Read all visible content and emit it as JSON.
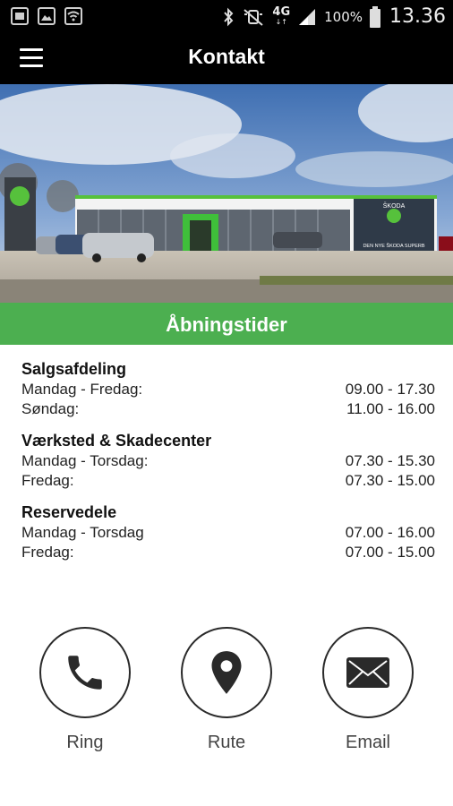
{
  "status_bar": {
    "network": "4G",
    "battery": "100%",
    "time": "13.36",
    "icons": [
      "storage-icon",
      "image-icon",
      "wifi-icon",
      "bluetooth-icon",
      "mute-icon",
      "signal-icon",
      "battery-icon"
    ]
  },
  "app_bar": {
    "title": "Kontakt",
    "menu_icon": "hamburger-icon"
  },
  "hero": {
    "sign_text": "ŠKODA",
    "banner_text": "DEN NYE ŠKODA SUPERB"
  },
  "opening_hours": {
    "title": "Åbningstider",
    "sections": [
      {
        "title": "Salgsafdeling",
        "rows": [
          {
            "day": "Mandag - Fredag:",
            "time": "09.00 - 17.30"
          },
          {
            "day": "Søndag:",
            "time": "11.00 - 16.00"
          }
        ]
      },
      {
        "title": "Værksted & Skadecenter",
        "rows": [
          {
            "day": "Mandag - Torsdag:",
            "time": "07.30 - 15.30"
          },
          {
            "day": "Fredag:",
            "time": "07.30 - 15.00"
          }
        ]
      },
      {
        "title": "Reservedele",
        "rows": [
          {
            "day": "Mandag - Torsdag",
            "time": "07.00 - 16.00"
          },
          {
            "day": "Fredag:",
            "time": "07.00 - 15.00"
          }
        ]
      }
    ]
  },
  "actions": [
    {
      "label": "Ring",
      "icon": "phone-icon"
    },
    {
      "label": "Rute",
      "icon": "map-pin-icon"
    },
    {
      "label": "Email",
      "icon": "envelope-icon"
    }
  ],
  "colors": {
    "accent": "#4caf50",
    "bar": "#000000"
  }
}
